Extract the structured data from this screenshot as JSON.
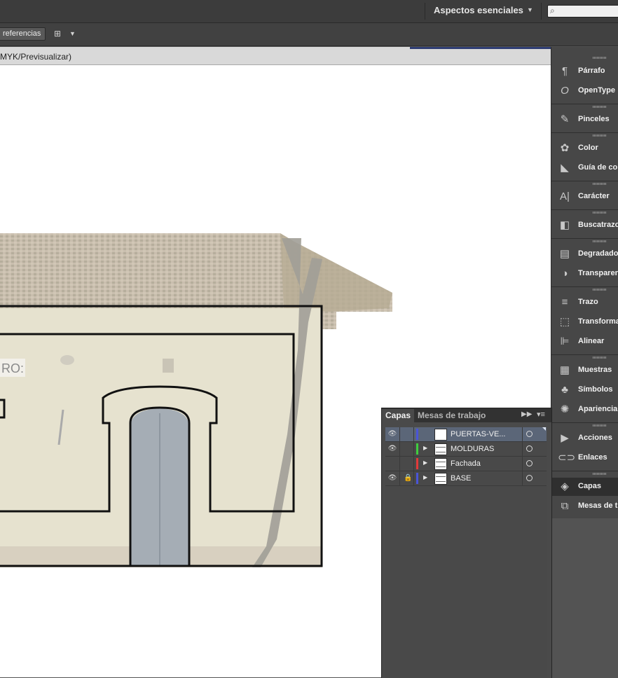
{
  "app": {
    "workspace_label": "Aspectos esenciales",
    "preferences_label": "referencias",
    "document_title": "MYK/Previsualizar)"
  },
  "dock": {
    "items": [
      {
        "label": "Párrafo",
        "icon": "paragraph-icon"
      },
      {
        "label": "OpenType",
        "icon": "opentype-icon"
      },
      {
        "label": "Pinceles",
        "icon": "brushes-icon"
      },
      {
        "label": "Color",
        "icon": "color-palette-icon"
      },
      {
        "label": "Guía de col",
        "icon": "color-guide-icon"
      },
      {
        "label": "Carácter",
        "icon": "character-icon"
      },
      {
        "label": "Buscatrazos",
        "icon": "pathfinder-icon"
      },
      {
        "label": "Degradado",
        "icon": "gradient-icon"
      },
      {
        "label": "Transparen",
        "icon": "transparency-icon"
      },
      {
        "label": "Trazo",
        "icon": "stroke-icon"
      },
      {
        "label": "Transforma",
        "icon": "transform-icon"
      },
      {
        "label": "Alinear",
        "icon": "align-icon"
      },
      {
        "label": "Muestras",
        "icon": "swatches-icon"
      },
      {
        "label": "Símbolos",
        "icon": "symbols-icon"
      },
      {
        "label": "Apariencia",
        "icon": "appearance-icon"
      },
      {
        "label": "Acciones",
        "icon": "actions-icon"
      },
      {
        "label": "Enlaces",
        "icon": "links-icon"
      },
      {
        "label": "Capas",
        "icon": "layers-icon",
        "active": true
      },
      {
        "label": "Mesas de tr",
        "icon": "artboards-icon"
      }
    ]
  },
  "layers_panel": {
    "tabs": [
      "Capas",
      "Mesas de trabajo"
    ],
    "layers": [
      {
        "name": "PUERTAS-VE...",
        "visible": true,
        "locked": false,
        "color": "#4a55d8",
        "expandable": false,
        "selected": true
      },
      {
        "name": "MOLDURAS",
        "visible": true,
        "locked": false,
        "color": "#3fce3f",
        "expandable": true,
        "selected": false
      },
      {
        "name": "Fachada",
        "visible": false,
        "locked": false,
        "color": "#e23a3a",
        "expandable": true,
        "selected": false
      },
      {
        "name": "BASE",
        "visible": true,
        "locked": true,
        "color": "#4a55d8",
        "expandable": true,
        "selected": false
      }
    ]
  },
  "canvas": {
    "facade_sign": "RO:"
  },
  "colors": {
    "interface_dark": "#3c3c3c",
    "panel": "#474747",
    "selected_layer": "#5b6678"
  }
}
